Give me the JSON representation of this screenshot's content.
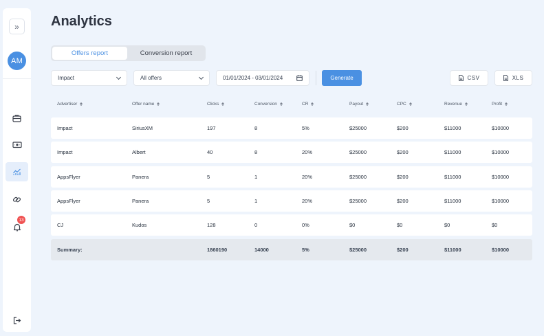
{
  "sidebar": {
    "avatar_initials": "AM",
    "notification_count": "13",
    "items": [
      {
        "icon": "briefcase-icon"
      },
      {
        "icon": "money-icon"
      },
      {
        "icon": "analytics-chart-icon"
      },
      {
        "icon": "link-icon"
      },
      {
        "icon": "bell-icon"
      }
    ]
  },
  "page": {
    "title": "Analytics"
  },
  "tabs": [
    {
      "label": "Offers report",
      "active": true
    },
    {
      "label": "Conversion report",
      "active": false
    }
  ],
  "filters": {
    "advertiser": "Impact",
    "offers": "All offers",
    "date_range": "01/01/2024 - 03/01/2024",
    "generate_label": "Generate",
    "csv_label": "CSV",
    "xls_label": "XLS"
  },
  "table": {
    "columns": [
      "Advertiser",
      "Offer name",
      "Clicks",
      "Conversion",
      "CR",
      "Payout",
      "CPC",
      "Revenue",
      "Profit"
    ],
    "rows": [
      [
        "Impact",
        "SiriusXM",
        "197",
        "8",
        "5%",
        "$25000",
        "$200",
        "$11000",
        "$10000"
      ],
      [
        "Impact",
        "Albert",
        "40",
        "8",
        "20%",
        "$25000",
        "$200",
        "$11000",
        "$10000"
      ],
      [
        "AppsFlyer",
        "Panera",
        "5",
        "1",
        "20%",
        "$25000",
        "$200",
        "$11000",
        "$10000"
      ],
      [
        "AppsFlyer",
        "Panera",
        "5",
        "1",
        "20%",
        "$25000",
        "$200",
        "$11000",
        "$10000"
      ],
      [
        "CJ",
        "Kudos",
        "128",
        "0",
        "0%",
        "$0",
        "$0",
        "$0",
        "$0"
      ]
    ],
    "summary": [
      "Summary:",
      "",
      "1860190",
      "14000",
      "5%",
      "$25000",
      "$200",
      "$11000",
      "$10000"
    ]
  },
  "colors": {
    "accent": "#4a90e2",
    "badge": "#f05252",
    "background": "#eef4fc"
  }
}
